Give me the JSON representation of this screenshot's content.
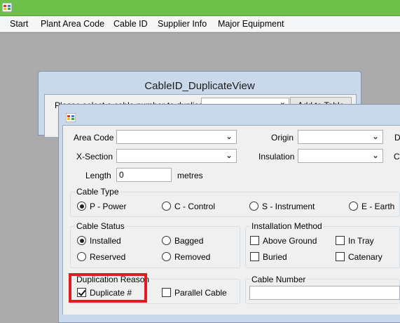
{
  "menu": {
    "items": [
      "Start",
      "Plant Area Code",
      "Cable ID",
      "Supplier Info",
      "Major Equipment"
    ]
  },
  "back_window": {
    "title": "CableID_DuplicateView",
    "prompt": "Please select a cable number to duplicate:",
    "button": "Add to Table"
  },
  "form": {
    "area_code_label": "Area Code",
    "origin_label": "Origin",
    "d_label": "D",
    "xsection_label": "X-Section",
    "insulation_label": "Insulation",
    "c_label": "C",
    "length_label": "Length",
    "length_value": "0",
    "length_unit": "metres"
  },
  "cable_type": {
    "title": "Cable Type",
    "options": [
      "P - Power",
      "C - Control",
      "S - Instrument",
      "E - Earth"
    ],
    "selected": "P - Power"
  },
  "cable_status": {
    "title": "Cable Status",
    "options": [
      "Installed",
      "Bagged",
      "Reserved",
      "Removed"
    ],
    "selected": "Installed"
  },
  "installation_method": {
    "title": "Installation Method",
    "options": [
      "Above Ground",
      "In Tray",
      "Buried",
      "Catenary"
    ]
  },
  "duplication_reason": {
    "title": "Duplication Reason",
    "options": [
      "Duplicate #",
      "Parallel Cable"
    ],
    "checked": "Duplicate #"
  },
  "cable_number": {
    "title": "Cable Number"
  },
  "colors": {
    "titlebar": "#6fc04a",
    "highlight": "#e21b23",
    "mdi_background": "#ababab"
  }
}
